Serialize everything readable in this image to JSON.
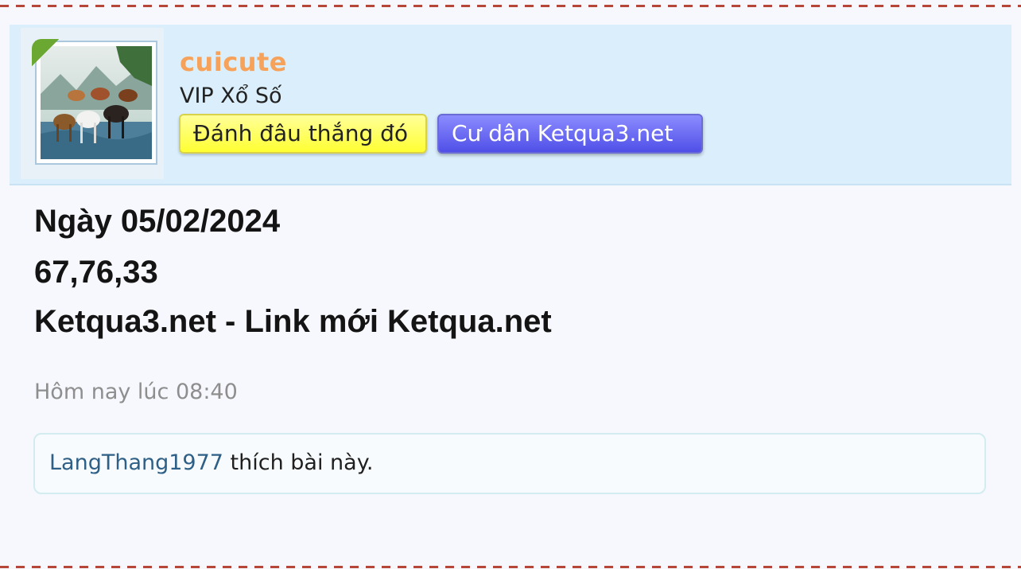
{
  "user": {
    "username": "cuicute",
    "title": "VIP Xổ Số",
    "banners": [
      {
        "label": "Đánh đâu thắng đó"
      },
      {
        "label": "Cư dân Ketqua3.net"
      }
    ]
  },
  "post": {
    "lines": [
      "Ngày 05/02/2024",
      "67,76,33",
      "Ketqua3.net - Link mới Ketqua.net"
    ],
    "date": "Hôm nay lúc 08:40"
  },
  "likes": {
    "user": "LangThang1977",
    "suffix": " thích bài này."
  },
  "colors": {
    "username": "#f6a25a",
    "header_bg": "#daeefb",
    "banner_yellow": "#ffff66",
    "banner_blue": "#6a6af5",
    "divider": "#b5473a",
    "like_link": "#2e5f86"
  },
  "icons": {
    "online": "online-indicator-icon"
  }
}
